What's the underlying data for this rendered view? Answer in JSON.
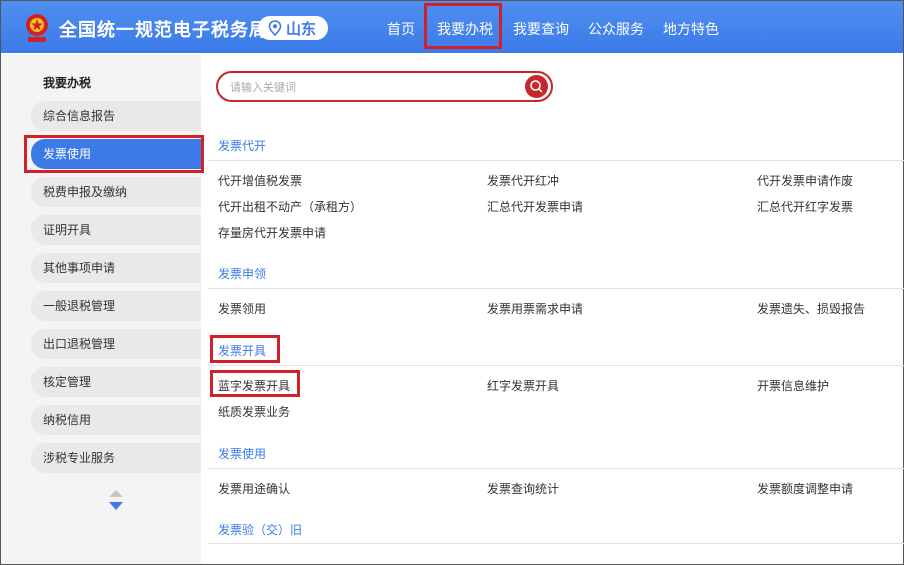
{
  "header": {
    "title": "全国统一规范电子税务局",
    "region": "山东",
    "nav": [
      "首页",
      "我要办税",
      "我要查询",
      "公众服务",
      "地方特色"
    ],
    "active_nav": "我要办税",
    "colors": {
      "bar": "#3c7ae8",
      "highlight": "#d0202a"
    }
  },
  "sidebar": {
    "title": "我要办税",
    "items": [
      "综合信息报告",
      "发票使用",
      "税费申报及缴纳",
      "证明开具",
      "其他事项申请",
      "一般退税管理",
      "出口退税管理",
      "核定管理",
      "纳税信用",
      "涉税专业服务"
    ],
    "active": "发票使用"
  },
  "search": {
    "placeholder": "请输入关键词",
    "value": ""
  },
  "sections": [
    {
      "title": "发票代开",
      "rows": [
        [
          "代开增值税发票",
          "发票代开红冲",
          "代开发票申请作废"
        ],
        [
          "代开出租不动产（承租方）",
          "汇总代开发票申请",
          "汇总代开红字发票"
        ],
        [
          "存量房代开发票申请"
        ]
      ]
    },
    {
      "title": "发票申领",
      "rows": [
        [
          "发票领用",
          "发票用票需求申请",
          "发票遗失、损毁报告"
        ]
      ]
    },
    {
      "title": "发票开具",
      "rows": [
        [
          "蓝字发票开具",
          "红字发票开具",
          "开票信息维护"
        ],
        [
          "纸质发票业务"
        ]
      ]
    },
    {
      "title": "发票使用",
      "rows": [
        [
          "发票用途确认",
          "发票查询统计",
          "发票额度调整申请"
        ]
      ]
    },
    {
      "title": "发票验（交）旧",
      "rows": []
    }
  ]
}
